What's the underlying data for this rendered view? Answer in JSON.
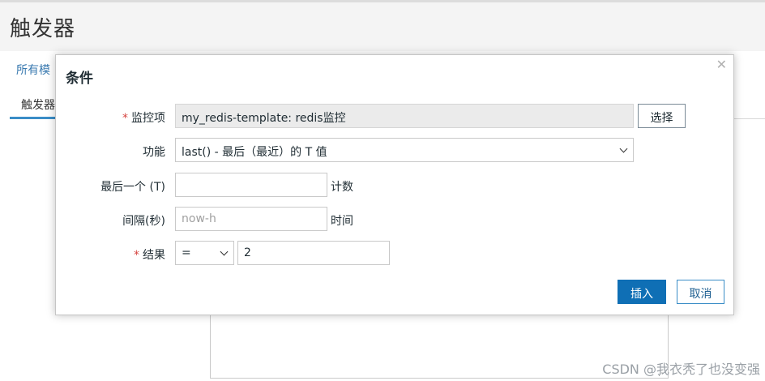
{
  "page": {
    "title": "触发器",
    "filter_link": "所有模",
    "active_tab": "触发器",
    "watermark": "CSDN @我衣秃了也没变强"
  },
  "dialog": {
    "title": "条件",
    "close_icon": "close-icon",
    "fields": {
      "item": {
        "label": "监控项",
        "required": true,
        "value": "my_redis-template: redis监控",
        "select_button": "选择"
      },
      "function": {
        "label": "功能",
        "value": "last() - 最后（最近）的 T 值"
      },
      "last_of": {
        "label": "最后一个 (T)",
        "value": "",
        "suffix": "计数"
      },
      "time_shift": {
        "label": "间隔(秒)",
        "placeholder": "now-h",
        "suffix": "时间"
      },
      "result": {
        "label": "结果",
        "required": true,
        "operator": "=",
        "value": "2"
      }
    },
    "buttons": {
      "insert": "插入",
      "cancel": "取消"
    }
  },
  "colors": {
    "primary": "#0f6fb5",
    "required": "#d64541",
    "link": "#3a7ab0",
    "tab_underline": "#3a8dc7"
  }
}
